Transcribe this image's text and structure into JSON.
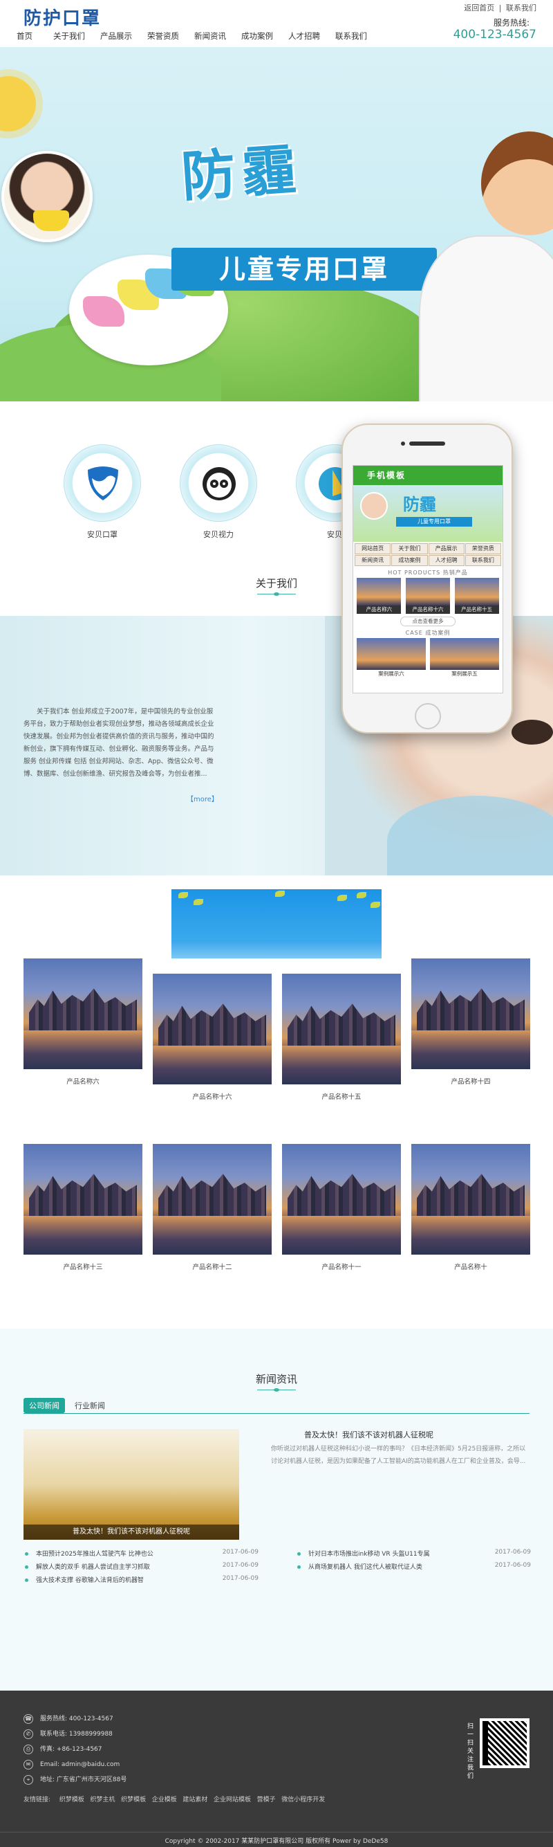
{
  "header": {
    "logo": "防护口罩",
    "toplinks": [
      "返回首页",
      "联系我们"
    ],
    "separator": "|",
    "hotline_label": "服务热线:",
    "hotline": "400-123-4567",
    "nav": [
      "首页",
      "关于我们",
      "产品展示",
      "荣誉资质",
      "新闻资讯",
      "成功案例",
      "人才招聘",
      "联系我们"
    ]
  },
  "banner": {
    "title": "防霾",
    "subtitle": "儿童专用口罩",
    "slides": 3,
    "active_slide": 1
  },
  "features": [
    "安贝口罩",
    "安贝视力",
    "安贝"
  ],
  "about": {
    "title": "关于我们",
    "text": "关于我们本 创业邦成立于2007年，是中国领先的专业创业服务平台，致力于帮助创业者实现创业梦想，推动各领域高成长企业快速发展。创业邦为创业者提供高价值的资讯与服务，推动中国的新创业，旗下拥有传媒互动、创业孵化、融资服务等业务。产品与服务 创业邦传媒 包括 创业邦网站、杂志、App、微信公众号、微博、数据库、创业创新维渔、研究报告及峰会等，为创业者推...",
    "more": "【more】"
  },
  "phone": {
    "title": "手机模板",
    "banner_title": "防霾",
    "banner_sub": "儿童专用口罩",
    "nav": [
      "网站首页",
      "关于我们",
      "产品展示",
      "荣誉资质",
      "新闻资讯",
      "成功案例",
      "人才招聘",
      "联系我们"
    ],
    "hot_label": "HOT PRODUCTS 热销产品",
    "products": [
      "产品名称六",
      "产品名称十六",
      "产品名称十五"
    ],
    "more": "点击查看更多",
    "case_label": "CASE 成功案例",
    "cases": [
      "案例展示六",
      "案例展示五"
    ]
  },
  "products": [
    "产品名称六",
    "产品名称十六",
    "产品名称十五",
    "产品名称十四",
    "产品名称十三",
    "产品名称十二",
    "产品名称十一",
    "产品名称十"
  ],
  "news": {
    "title": "新闻资讯",
    "tabs": [
      "公司新闻",
      "行业新闻"
    ],
    "active_tab": 0,
    "featured_caption": "普及太快！我们该不该对机器人征税呢",
    "featured_title": "普及太快！我们该不该对机器人征税呢",
    "featured_body": "你听说过对机器人征税这种科幻小说一样的事吗？《日本经济新闻》5月25日报道称，之所以讨论对机器人征税，是因为如果配备了人工智能AI的高功能机器人在工厂和企业普及，会导...",
    "left_list": [
      {
        "title": "本田预计2025年推出人驾驶汽车 比神也公",
        "date": "2017-06-09"
      },
      {
        "title": "解放人类的双手 机器人尝试自主学习抓取",
        "date": "2017-06-09"
      },
      {
        "title": "强大技术支撑 谷歌输入法背后的机器智",
        "date": "2017-06-09"
      }
    ],
    "right_list": [
      {
        "title": "针对日本市场推出ink移动 VR 头盔U11专属",
        "date": "2017-06-09"
      },
      {
        "title": "从商场复机器人 我们这代人被取代证人类",
        "date": "2017-06-09"
      }
    ]
  },
  "footer": {
    "info": [
      {
        "icon": "phone-icon",
        "label": "服务热线:",
        "value": "400-123-4567"
      },
      {
        "icon": "mobile-icon",
        "label": "联系电话:",
        "value": "13988999988"
      },
      {
        "icon": "fax-icon",
        "label": "传真:",
        "value": "+86-123-4567"
      },
      {
        "icon": "email-icon",
        "label": "Email:",
        "value": "admin@baidu.com"
      },
      {
        "icon": "location-icon",
        "label": "地址:",
        "value": "广东省广州市天河区88号"
      }
    ],
    "links_label": "友情链接:",
    "links": [
      "织梦模板",
      "织梦主机",
      "织梦模板",
      "企业模板",
      "建站素材",
      "企业网站模板",
      "营模子",
      "微信小程序开发"
    ],
    "qr_label": "扫一扫关注我们",
    "copyright": "Copyright © 2002-2017 某某防护口罩有限公司 版权所有 Power by DeDe58"
  }
}
